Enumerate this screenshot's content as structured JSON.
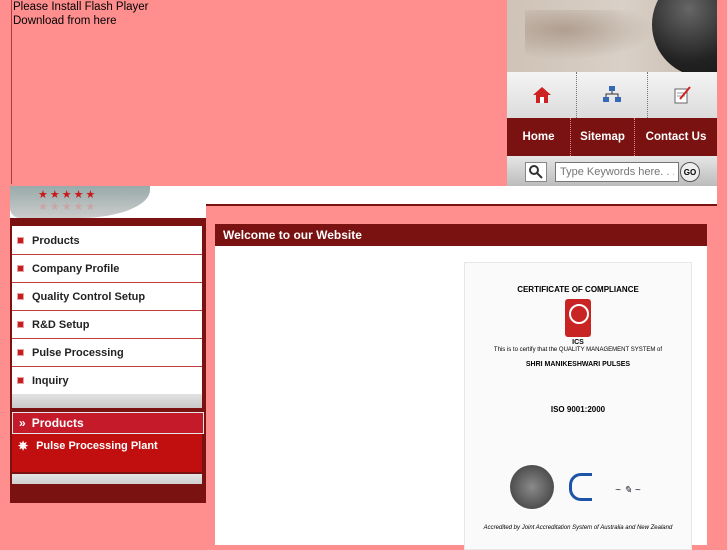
{
  "flash": {
    "line1": "Please Install Flash Player",
    "line2": "Download from here"
  },
  "icons": [
    "home-icon",
    "sitemap-icon",
    "contact-icon"
  ],
  "nav": {
    "home": "Home",
    "sitemap": "Sitemap",
    "contact": "Contact Us"
  },
  "search": {
    "placeholder": "Type Keywords here. . .",
    "go": "GO"
  },
  "stars": {
    "row": "★★★★★",
    "row2": "★★★★★"
  },
  "menu": [
    "Products",
    "Company Profile",
    "Quality Control Setup",
    "R&D Setup",
    "Pulse Processing",
    "Inquiry"
  ],
  "products_box": {
    "title": "Products",
    "item": "Pulse Processing Plant"
  },
  "main": {
    "title": "Welcome to our Website"
  },
  "certificate": {
    "heading": "CERTIFICATE OF COMPLIANCE",
    "logo_text": "ICS",
    "company": "SHRI MANIKESHWARI PULSES",
    "standard": "ISO 9001:2000",
    "sub": "This is to certify that the QUALITY MANAGEMENT SYSTEM of",
    "footer": "Accredited by Joint Accreditation System of Australia and New Zealand"
  },
  "colors": {
    "page_bg": "#ff8f8f",
    "maroon": "#7a1212",
    "red": "#c10f0f"
  }
}
